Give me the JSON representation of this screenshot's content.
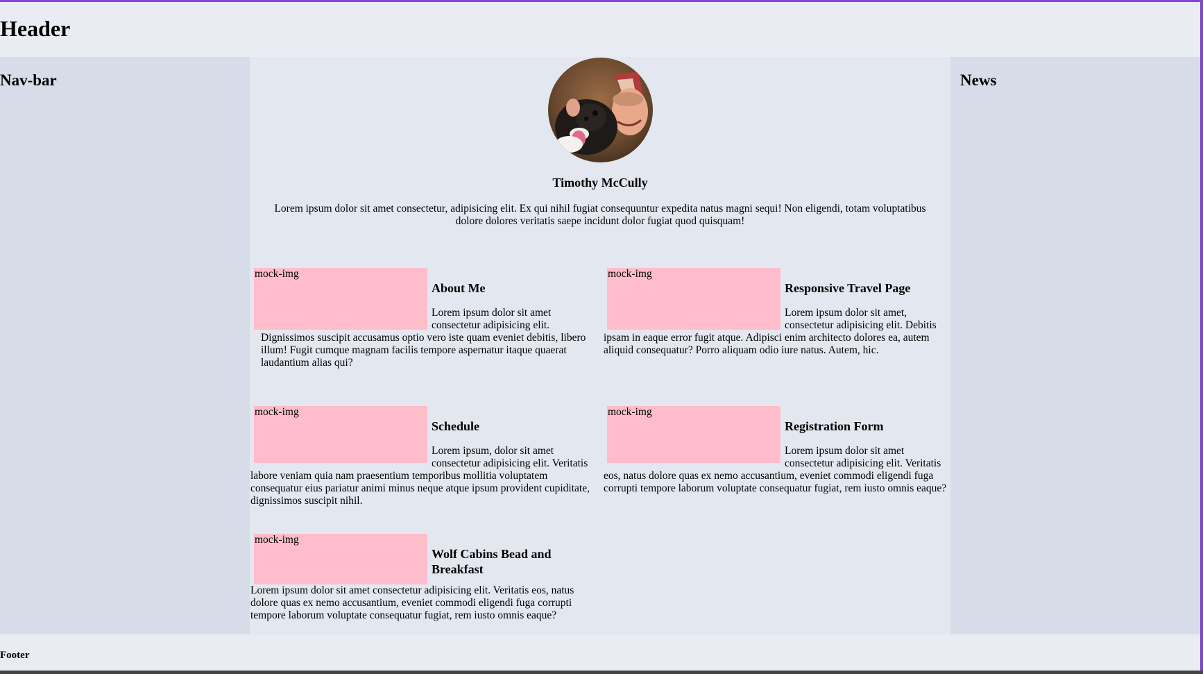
{
  "header": {
    "title": "Header"
  },
  "navbar": {
    "title": "Nav-bar"
  },
  "news": {
    "title": "News"
  },
  "profile": {
    "name": "Timothy McCully",
    "bio": "Lorem ipsum dolor sit amet consectetur, adipisicing elit. Ex qui nihil fugiat consequuntur expedita natus magni sequi! Non eligendi, totam voluptatibus dolore dolores veritatis saepe incidunt dolor fugiat quod quisquam!"
  },
  "cards": [
    {
      "image_label": "mock-img",
      "title": "About Me",
      "text_lead": "Lorem ipsum dolor sit amet consectetur adipisicing elit.",
      "text": "Dignissimos suscipit accusamus optio vero iste quam eveniet debitis, libero illum! Fugit cumque magnam facilis tempore aspernatur itaque quaerat laudantium alias qui?"
    },
    {
      "image_label": "mock-img",
      "title": "Responsive Travel Page",
      "text": "Lorem ipsum dolor sit amet, consectetur adipisicing elit. Debitis ipsam in eaque error fugit atque. Adipisci enim architecto dolores ea, autem aliquid consequatur? Porro aliquam odio iure natus. Autem, hic."
    },
    {
      "image_label": "mock-img",
      "title": "Schedule",
      "text": "Lorem ipsum, dolor sit amet consectetur adipisicing elit. Veritatis labore veniam quia nam praesentium temporibus mollitia voluptatem consequatur eius pariatur animi minus neque atque ipsum provident cupiditate, dignissimos suscipit nihil."
    },
    {
      "image_label": "mock-img",
      "title": "Registration Form",
      "text": "Lorem ipsum dolor sit amet consectetur adipisicing elit. Veritatis eos, natus dolore quas ex nemo accusantium, eveniet commodi eligendi fuga corrupti tempore laborum voluptate consequatur fugiat, rem iusto omnis eaque?"
    },
    {
      "image_label": "mock-img",
      "title": "Wolf Cabins Bead and Breakfast",
      "text": "Lorem ipsum dolor sit amet consectetur adipisicing elit. Veritatis eos, natus dolore quas ex nemo accusantium, eveniet commodi eligendi fuga corrupti tempore laborum voluptate consequatur fugiat, rem iusto omnis eaque?"
    }
  ],
  "footer": {
    "text": "Footer"
  },
  "colors": {
    "mock_image": "#ffbccb",
    "sidebar": "#d7dde8",
    "content": "#e3e7ef",
    "header": "#e9edf3",
    "accent_border": "#8a3fe0"
  }
}
